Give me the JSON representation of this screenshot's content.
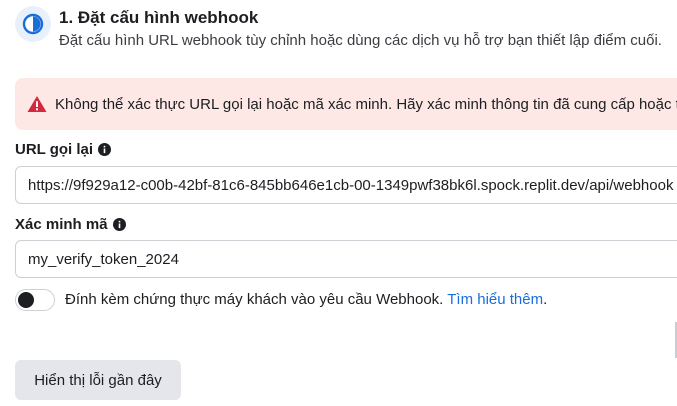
{
  "step": {
    "icon": "half-circle-step-icon",
    "title": "1. Đặt cấu hình webhook",
    "description": "Đặt cấu hình URL webhook tùy chỉnh hoặc dùng các dịch vụ hỗ trợ bạn thiết lập điểm cuối."
  },
  "error": {
    "icon": "warning-icon",
    "message": "Không thể xác thực URL gọi lại hoặc mã xác minh. Hãy xác minh thông tin đã cung cấp hoặc thử lại sau."
  },
  "callback": {
    "label": "URL gọi lại",
    "info_icon": "info-icon",
    "value": "https://9f929a12-c00b-42bf-81c6-845bb646e1cb-00-1349pwf38bk6l.spock.replit.dev/api/webhook"
  },
  "verify": {
    "label": "Xác minh mã",
    "info_icon": "info-icon",
    "value": "my_verify_token_2024"
  },
  "client_cert": {
    "enabled": false,
    "text": "Đính kèm chứng thực máy khách vào yêu cầu Webhook.",
    "link": "Tìm hiểu thêm",
    "suffix": "."
  },
  "recent_errors_button": "Hiển thị lỗi gần đây",
  "colors": {
    "accent": "#1a6ed8",
    "error_bg": "#fde8e6",
    "error_icon": "#d3293f",
    "button_bg": "#e4e6eb"
  }
}
